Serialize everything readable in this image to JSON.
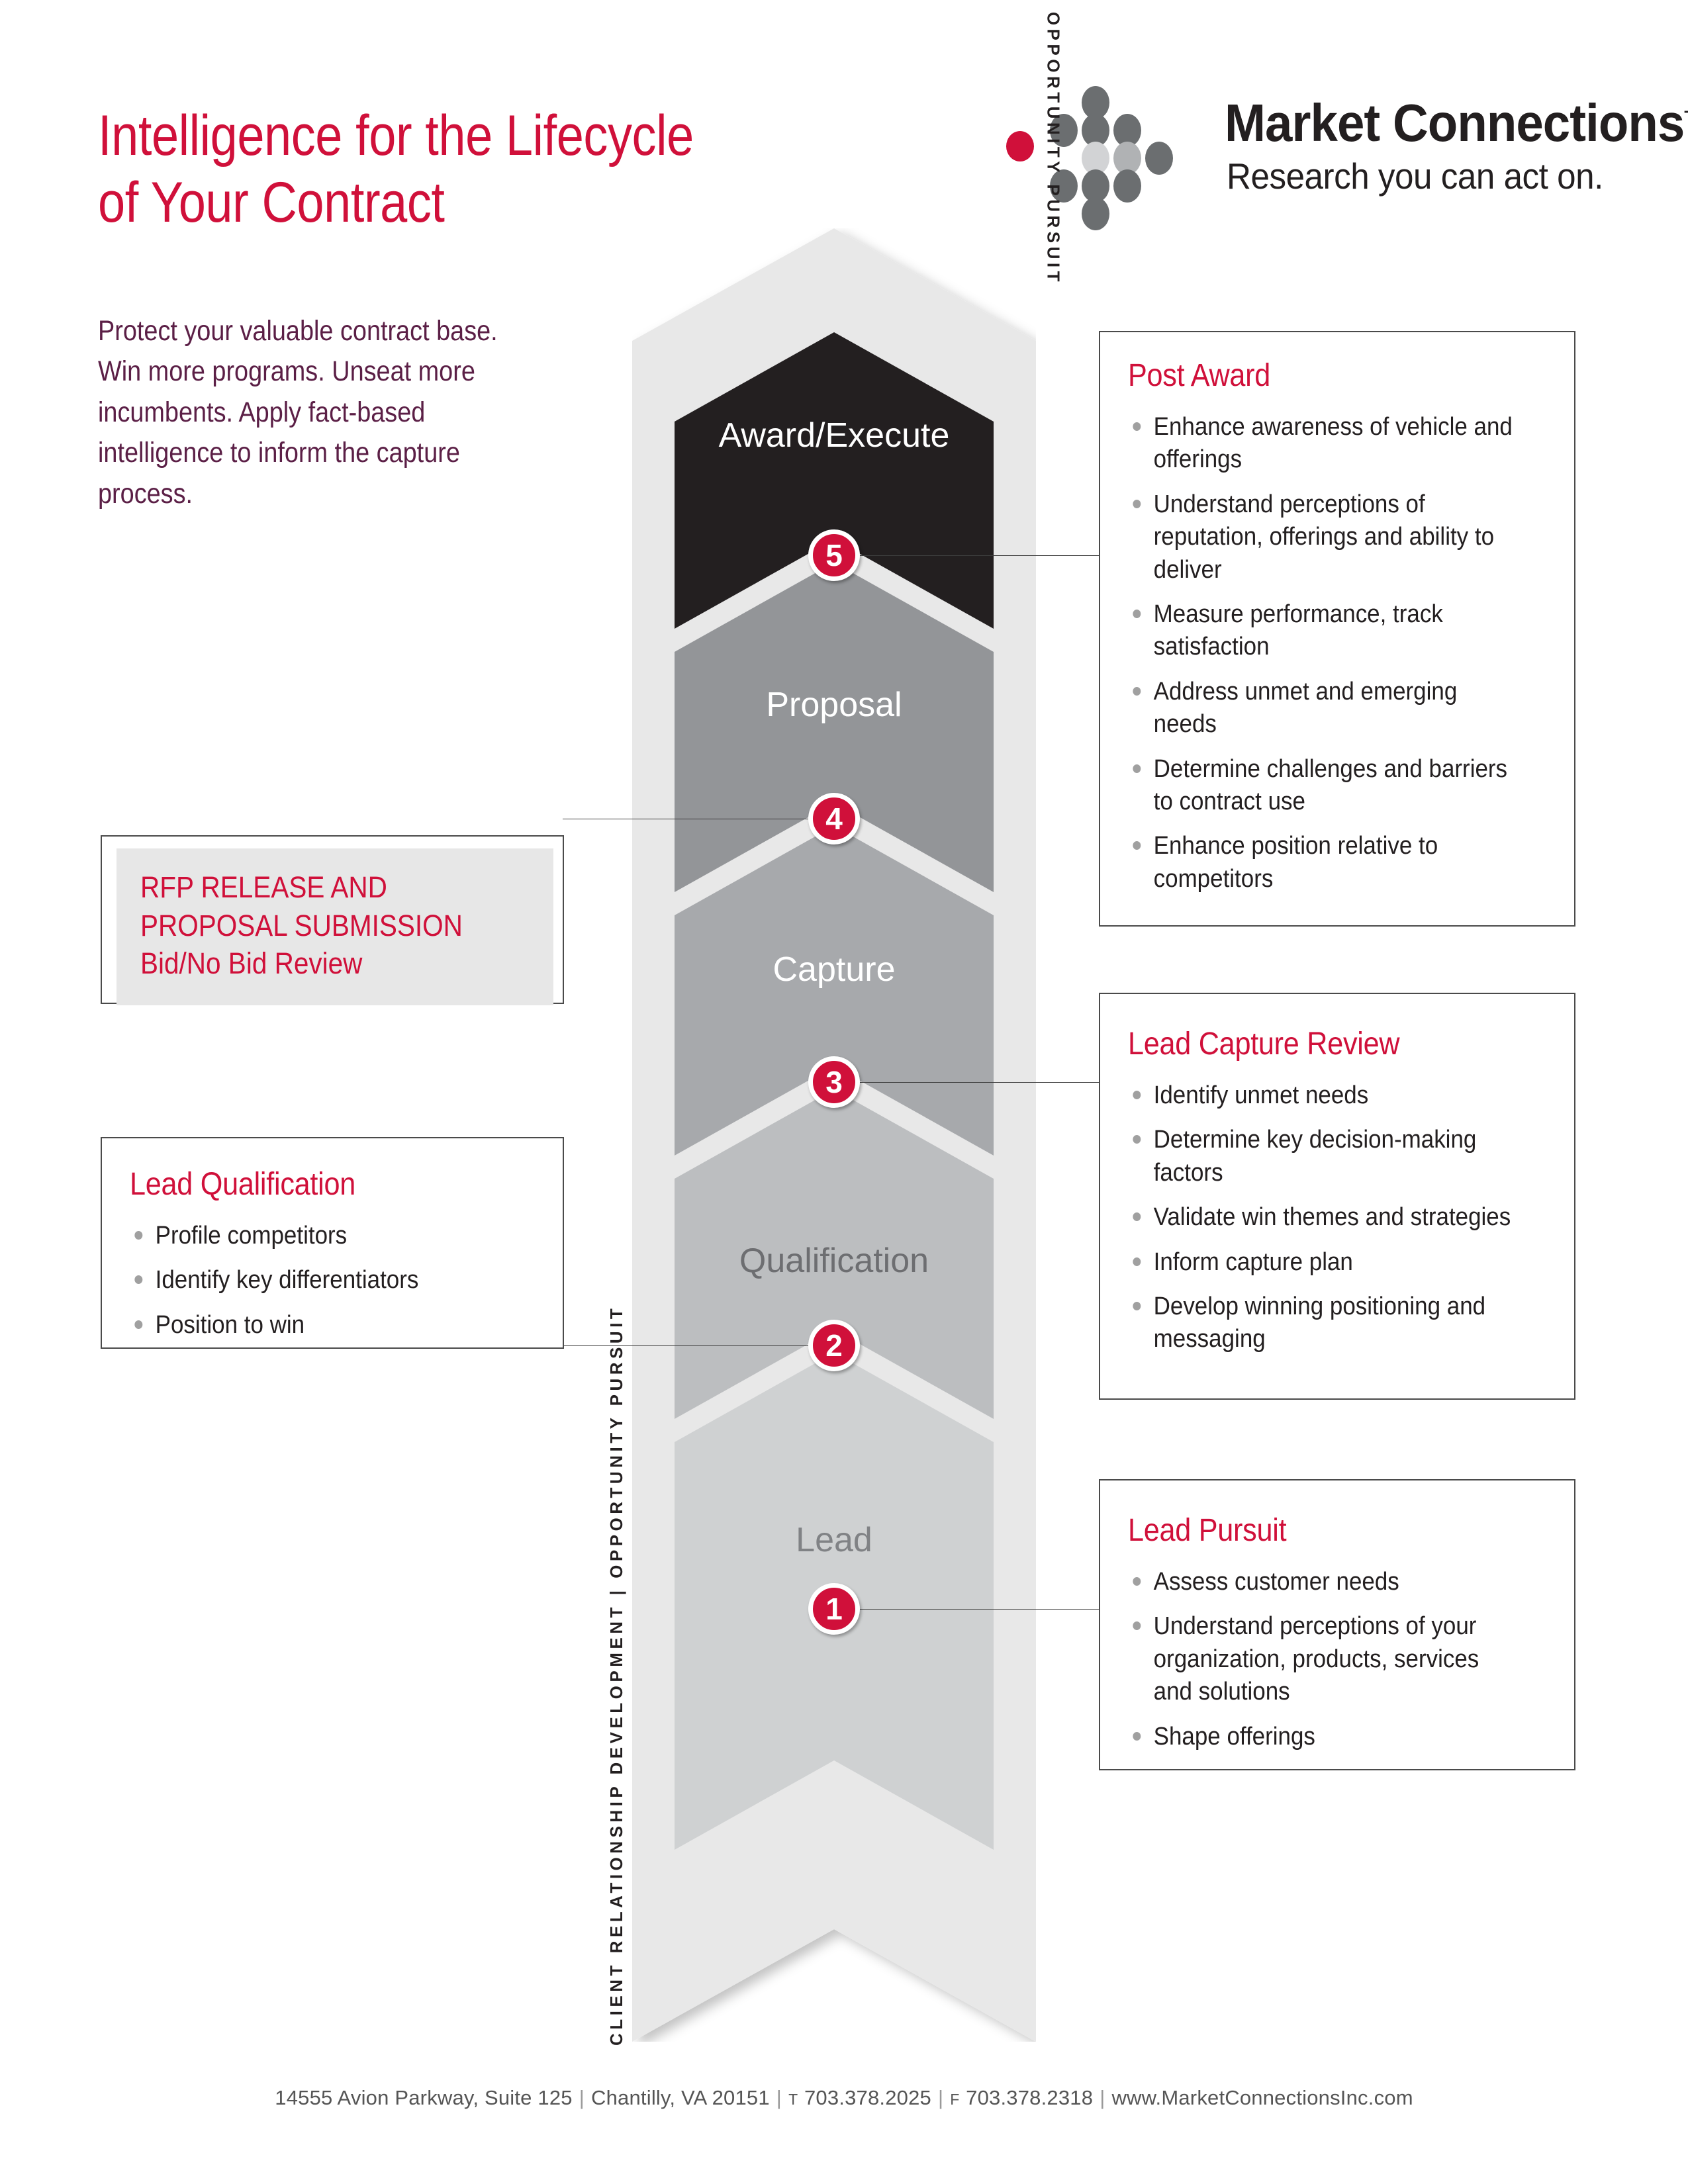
{
  "header": {
    "title_line1": "Intelligence for the Lifecycle",
    "title_line2": "of Your Contract",
    "intro": "Protect your valuable contract base. Win more programs. Unseat more incumbents. Apply fact-based intelligence to inform the capture process.",
    "accent_color": "#d0103a",
    "intro_color": "#5b1f46"
  },
  "logo": {
    "name": "Market Connections",
    "trademark": "TM",
    "tagline": "Research you can act on.",
    "dot_icon": "dot-grid-icon",
    "accent_dot_color": "#d0103a",
    "dot_color": "#6b6e70"
  },
  "ribbon": {
    "axis_left": "CLIENT RELATIONSHIP DEVELOPMENT  |  OPPORTUNITY PURSUIT",
    "axis_right": "CLIENT RELATIONSHIP DEVELOPMENT  |  OPPORTUNITY PURSUIT",
    "segments": [
      {
        "label": "Award/Execute",
        "fill": "#231f20",
        "text_color": "#ffffff"
      },
      {
        "label": "Proposal",
        "fill": "#939598",
        "text_color": "#ffffff"
      },
      {
        "label": "Capture",
        "fill": "#a7a9ac",
        "text_color": "#ffffff"
      },
      {
        "label": "Qualification",
        "fill": "#bcbec0",
        "text_color": "#6d6e71"
      },
      {
        "label": "Lead",
        "fill": "#cfd1d2",
        "text_color": "#808285"
      }
    ],
    "badges": [
      "1",
      "2",
      "3",
      "4",
      "5"
    ],
    "badge_color": "#d0103a"
  },
  "boxes": {
    "post_award": {
      "title": "Post Award",
      "items": [
        "Enhance awareness of vehicle and offerings",
        "Understand perceptions of reputation, offerings and ability to deliver",
        "Measure performance, track satisfaction",
        "Address unmet and emerging needs",
        "Determine challenges and barriers to contract use",
        "Enhance position relative to competitors"
      ]
    },
    "lead_capture_review": {
      "title": "Lead Capture Review",
      "items": [
        "Identify unmet needs",
        "Determine key decision-making factors",
        "Validate win themes and strategies",
        "Inform capture plan",
        "Develop winning positioning and messaging"
      ]
    },
    "lead_pursuit": {
      "title": "Lead Pursuit",
      "items": [
        "Assess customer needs",
        "Understand perceptions of your organization, products, services and solutions",
        "Shape offerings"
      ]
    },
    "lead_qualification": {
      "title": "Lead Qualification",
      "items": [
        "Profile competitors",
        "Identify key differentiators",
        "Position to win"
      ]
    },
    "rfp_release": {
      "line1": "RFP RELEASE AND",
      "line2": "PROPOSAL SUBMISSION",
      "line3": "Bid/No Bid Review",
      "shade_color": "#e7e7e7"
    }
  },
  "footer": {
    "address": "14555 Avion Parkway, Suite 125",
    "city": "Chantilly, VA 20151",
    "phone_label": "T",
    "phone": "703.378.2025",
    "fax_label": "F",
    "fax": "703.378.2318",
    "website": "www.MarketConnectionsInc.com"
  }
}
